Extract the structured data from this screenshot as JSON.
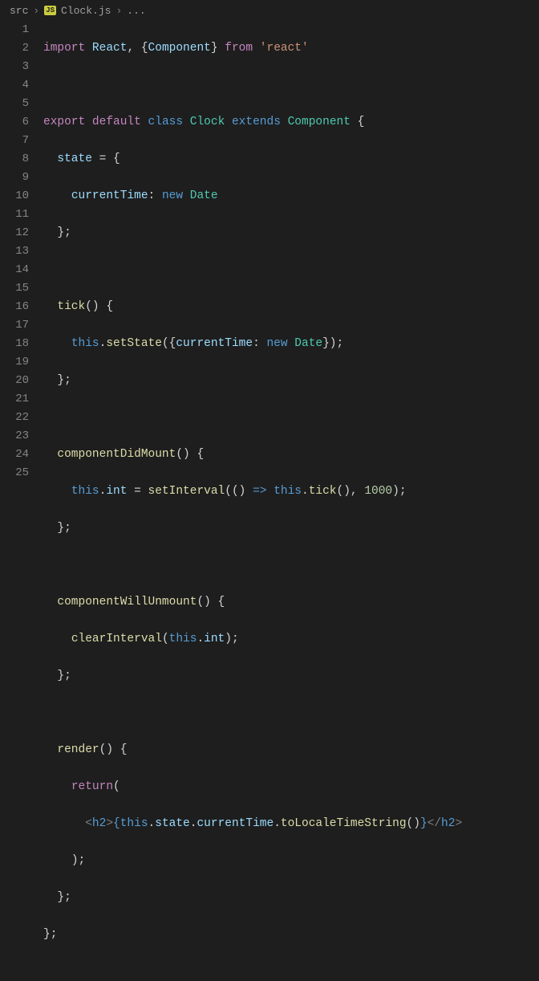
{
  "breadcrumb": {
    "folder": "src",
    "jsBadge": "JS",
    "file": "Clock.js",
    "ellipsis": "..."
  },
  "gutter": [
    "1",
    "2",
    "3",
    "4",
    "5",
    "6",
    "7",
    "8",
    "9",
    "10",
    "11",
    "12",
    "13",
    "14",
    "15",
    "16",
    "17",
    "18",
    "19",
    "20",
    "21",
    "22",
    "23",
    "24",
    "25"
  ],
  "tok": {
    "import": "import",
    "React": "React",
    "Component": "Component",
    "from": "from",
    "reactStr": "'react'",
    "export": "export",
    "default": "default",
    "class": "class",
    "Clock": "Clock",
    "extends": "extends",
    "state": "state",
    "currentTime": "currentTime",
    "new": "new",
    "Date": "Date",
    "tick": "tick",
    "this": "this",
    "setState": "setState",
    "componentDidMount": "componentDidMount",
    "int": "int",
    "setInterval": "setInterval",
    "thousand": "1000",
    "componentWillUnmount": "componentWillUnmount",
    "clearInterval": "clearInterval",
    "render": "render",
    "return": "return",
    "h2": "h2",
    "stateProp": "state",
    "toLocaleTimeString": "toLocaleTimeString"
  }
}
